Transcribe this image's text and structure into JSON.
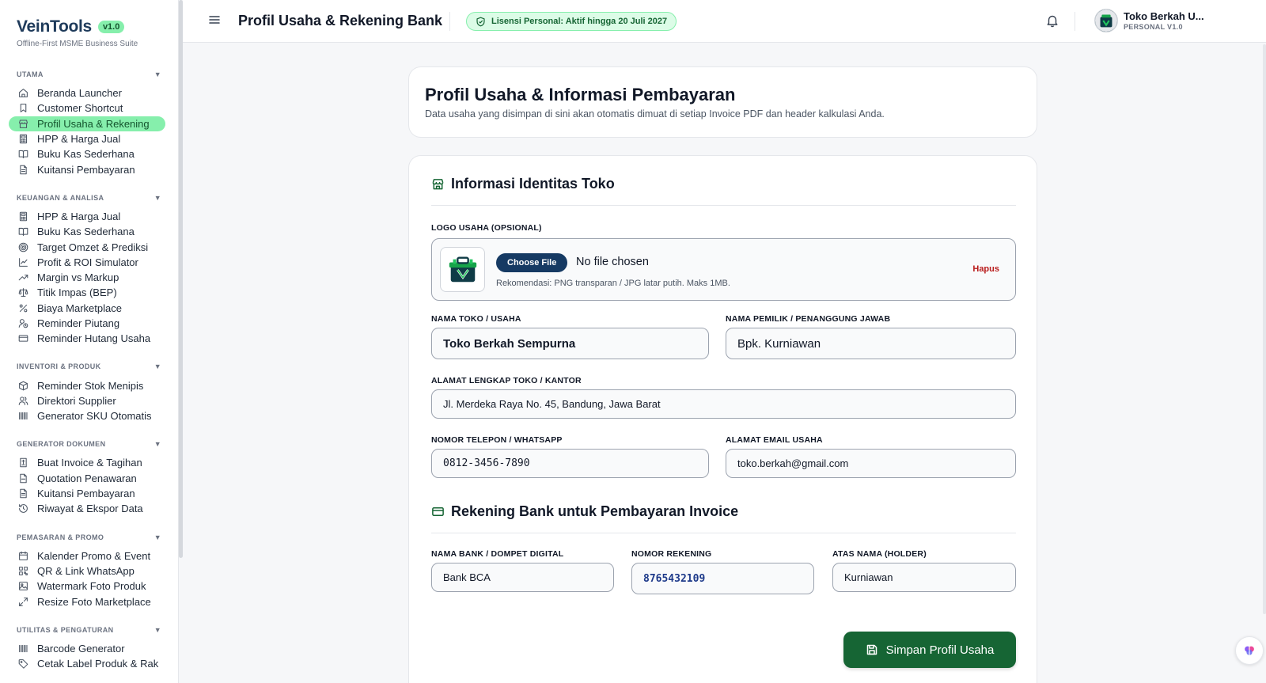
{
  "brand": {
    "name": "VeinTools",
    "version": "v1.0",
    "tagline": "Offline-First MSME Business Suite"
  },
  "sidebar": {
    "sections": [
      {
        "title": "UTAMA",
        "items": [
          {
            "label": "Beranda Launcher",
            "icon": "home-icon"
          },
          {
            "label": "Customer Shortcut",
            "icon": "bookmark-icon"
          },
          {
            "label": "Profil Usaha & Rekening",
            "icon": "store-icon",
            "active": true
          },
          {
            "label": "HPP & Harga Jual",
            "icon": "calculator-icon"
          },
          {
            "label": "Buku Kas Sederhana",
            "icon": "book-open-icon"
          },
          {
            "label": "Kuitansi Pembayaran",
            "icon": "file-text-icon"
          }
        ]
      },
      {
        "title": "KEUANGAN & ANALISA",
        "items": [
          {
            "label": "HPP & Harga Jual",
            "icon": "calculator-icon"
          },
          {
            "label": "Buku Kas Sederhana",
            "icon": "book-open-icon"
          },
          {
            "label": "Target Omzet & Prediksi",
            "icon": "target-icon"
          },
          {
            "label": "Profit & ROI Simulator",
            "icon": "line-chart-icon"
          },
          {
            "label": "Margin vs Markup",
            "icon": "trending-up-icon"
          },
          {
            "label": "Titik Impas (BEP)",
            "icon": "scale-icon"
          },
          {
            "label": "Biaya Marketplace",
            "icon": "percent-icon"
          },
          {
            "label": "Reminder Piutang",
            "icon": "user-clock-icon"
          },
          {
            "label": "Reminder Hutang Usaha",
            "icon": "credit-card-icon"
          }
        ]
      },
      {
        "title": "INVENTORI & PRODUK",
        "items": [
          {
            "label": "Reminder Stok Menipis",
            "icon": "package-icon"
          },
          {
            "label": "Direktori Supplier",
            "icon": "users-icon"
          },
          {
            "label": "Generator SKU Otomatis",
            "icon": "barcode-icon"
          }
        ]
      },
      {
        "title": "GENERATOR DOKUMEN",
        "items": [
          {
            "label": "Buat Invoice & Tagihan",
            "icon": "invoice-icon"
          },
          {
            "label": "Quotation Penawaran",
            "icon": "file-icon"
          },
          {
            "label": "Kuitansi Pembayaran",
            "icon": "file-text-icon"
          },
          {
            "label": "Riwayat & Ekspor Data",
            "icon": "history-icon"
          }
        ]
      },
      {
        "title": "PEMASARAN & PROMO",
        "items": [
          {
            "label": "Kalender Promo & Event",
            "icon": "calendar-icon"
          },
          {
            "label": "QR & Link WhatsApp",
            "icon": "qr-icon"
          },
          {
            "label": "Watermark Foto Produk",
            "icon": "image-icon"
          },
          {
            "label": "Resize Foto Marketplace",
            "icon": "resize-icon"
          }
        ]
      },
      {
        "title": "UTILITAS & PENGATURAN",
        "items": [
          {
            "label": "Barcode Generator",
            "icon": "barcode-icon"
          },
          {
            "label": "Cetak Label Produk & Rak",
            "icon": "tag-icon"
          }
        ]
      }
    ]
  },
  "header": {
    "title": "Profil Usaha & Rekening Bank",
    "license": "Lisensi Personal: Aktif hingga 20 Juli 2027",
    "user_name": "Toko Berkah U...",
    "user_role": "PERSONAL V1.0"
  },
  "intro": {
    "title": "Profil Usaha & Informasi Pembayaran",
    "description": "Data usaha yang disimpan di sini akan otomatis dimuat di setiap Invoice PDF dan header kalkulasi Anda."
  },
  "identity": {
    "title": "Informasi Identitas Toko",
    "logo_label": "LOGO USAHA (OPSIONAL)",
    "choose_file": "Choose File",
    "file_status": "No file chosen",
    "logo_hint": "Rekomendasi: PNG transparan / JPG latar putih. Maks 1MB.",
    "remove": "Hapus",
    "store_name_label": "NAMA TOKO / USAHA",
    "store_name": "Toko Berkah Sempurna",
    "owner_label": "NAMA PEMILIK / PENANGGUNG JAWAB",
    "owner": "Bpk. Kurniawan",
    "address_label": "ALAMAT LENGKAP TOKO / KANTOR",
    "address": "Jl. Merdeka Raya No. 45, Bandung, Jawa Barat",
    "phone_label": "NOMOR TELEPON / WHATSAPP",
    "phone": "0812-3456-7890",
    "email_label": "ALAMAT EMAIL USAHA",
    "email": "toko.berkah@gmail.com"
  },
  "bank": {
    "title": "Rekening Bank untuk Pembayaran Invoice",
    "bank_label": "NAMA BANK / DOMPET DIGITAL",
    "bank_name": "Bank BCA",
    "account_label": "NOMOR REKENING",
    "account_number": "8765432109",
    "holder_label": "ATAS NAMA (HOLDER)",
    "holder": "Kurniawan"
  },
  "save_label": "Simpan Profil Usaha",
  "colors": {
    "primary_green": "#166534",
    "accent_green": "#86efac",
    "navy": "#163a63",
    "danger": "#b91c1c"
  }
}
